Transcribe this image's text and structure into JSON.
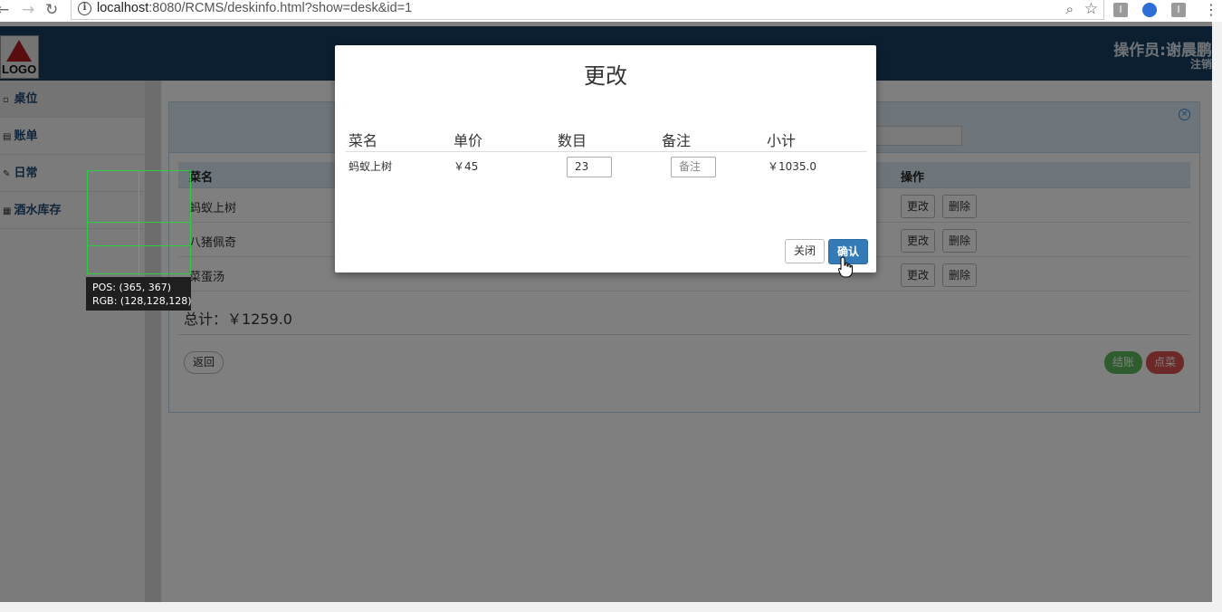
{
  "browser": {
    "url_host": "localhost",
    "url_rest": ":8080/RCMS/deskinfo.html?show=desk&id=1",
    "back_glyph": "←",
    "forward_glyph": "→",
    "reload_glyph": "↻",
    "ext1": "I",
    "ext3": "I"
  },
  "header": {
    "logo_text": "LOGO",
    "operator": "操作员:谢晨鹏",
    "logout": "注销"
  },
  "sidebar": {
    "items": [
      {
        "label": "桌位"
      },
      {
        "label": "账单"
      },
      {
        "label": "日常"
      },
      {
        "label": "酒水库存"
      }
    ]
  },
  "bill": {
    "columns": {
      "name": "菜名",
      "action": "操作"
    },
    "rows": [
      {
        "name": "蚂蚁上树"
      },
      {
        "name": "八猪佩奇"
      },
      {
        "name": "菜蛋汤"
      }
    ],
    "edit_label": "更改",
    "delete_label": "删除",
    "total": "总计：￥1259.0",
    "back_label": "返回",
    "pay_label": "结账",
    "order_label": "点菜"
  },
  "modal": {
    "title": "更改",
    "columns": {
      "name": "菜名",
      "price": "单价",
      "qty": "数目",
      "note": "备注",
      "subtotal": "小计"
    },
    "row": {
      "name": "蚂蚁上树",
      "price": "￥45",
      "qty": "23",
      "note_placeholder": "备注",
      "subtotal": "￥1035.0"
    },
    "close_label": "关闭",
    "confirm_label": "确认"
  },
  "picker": {
    "pos": "POS:  (365, 367)",
    "rgb": "RGB:  (128,128,128)"
  },
  "colors": {
    "header_bg": "#173f63",
    "primary": "#337ab7",
    "success": "#5cb85c",
    "danger": "#d9534f"
  }
}
